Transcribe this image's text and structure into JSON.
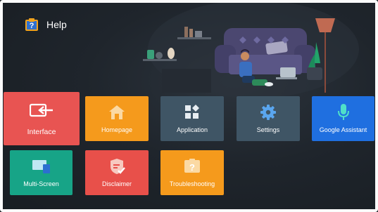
{
  "header": {
    "title": "Help",
    "icon": "help-book-icon"
  },
  "tiles": [
    {
      "label": "Interface",
      "icon": "interface-icon",
      "color": "#e85452"
    },
    {
      "label": "Homepage",
      "icon": "home-icon",
      "color": "#f59a1c"
    },
    {
      "label": "Application",
      "icon": "apps-grid-icon",
      "color": "#3f5565"
    },
    {
      "label": "Settings",
      "icon": "gear-icon",
      "color": "#3f5565"
    },
    {
      "label": "Google Assistant",
      "icon": "microphone-icon",
      "color": "#1f6fe0"
    },
    {
      "label": "Multi-Screen",
      "icon": "multi-screen-icon",
      "color": "#17a487"
    },
    {
      "label": "Disclaimer",
      "icon": "disclaimer-shield-icon",
      "color": "#e8504a"
    },
    {
      "label": "Troubleshooting",
      "icon": "question-box-icon",
      "color": "#f59a1c"
    }
  ]
}
